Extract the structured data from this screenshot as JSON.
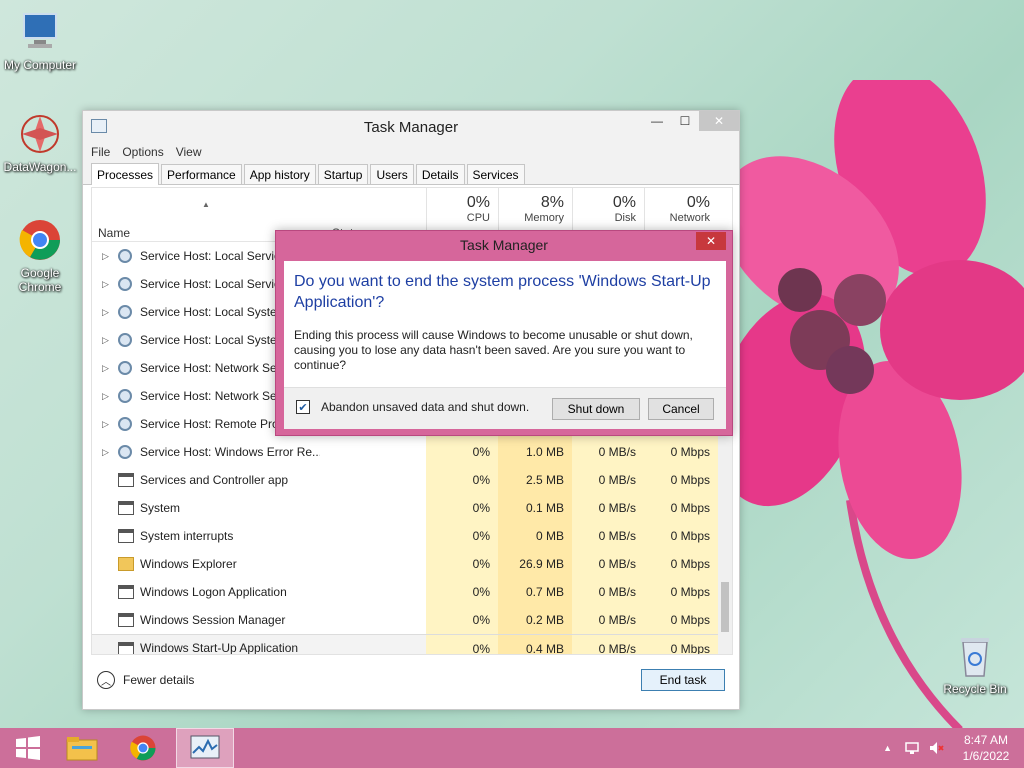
{
  "desktop": {
    "icons": [
      {
        "label": "My Computer"
      },
      {
        "label": "DataWagon..."
      },
      {
        "label": "Google Chrome"
      },
      {
        "label": "Recycle Bin"
      }
    ]
  },
  "window": {
    "title": "Task Manager",
    "minimize": "—",
    "maximize": "☐",
    "close": "✕",
    "menu": [
      "File",
      "Options",
      "View"
    ],
    "tabs": [
      "Processes",
      "Performance",
      "App history",
      "Startup",
      "Users",
      "Details",
      "Services"
    ],
    "active_tab": 0
  },
  "columns": {
    "name": "Name",
    "status": "Status",
    "cpu_pct": "0%",
    "cpu_label": "CPU",
    "mem_pct": "8%",
    "mem_label": "Memory",
    "disk_pct": "0%",
    "disk_label": "Disk",
    "net_pct": "0%",
    "net_label": "Network"
  },
  "processes": [
    {
      "name": "Service Host: Local Service",
      "cpu": "",
      "mem": "",
      "disk": "",
      "net": "",
      "icon": "gear-icon",
      "expand": true
    },
    {
      "name": "Service Host: Local Service",
      "cpu": "",
      "mem": "",
      "disk": "",
      "net": "",
      "icon": "gear-icon",
      "expand": true
    },
    {
      "name": "Service Host: Local System",
      "cpu": "",
      "mem": "",
      "disk": "",
      "net": "",
      "icon": "gear-icon",
      "expand": true
    },
    {
      "name": "Service Host: Local System",
      "cpu": "",
      "mem": "",
      "disk": "",
      "net": "",
      "icon": "gear-icon",
      "expand": true
    },
    {
      "name": "Service Host: Network Service",
      "cpu": "",
      "mem": "",
      "disk": "",
      "net": "",
      "icon": "gear-icon",
      "expand": true
    },
    {
      "name": "Service Host: Network Service",
      "cpu": "",
      "mem": "",
      "disk": "",
      "net": "",
      "icon": "gear-icon",
      "expand": true
    },
    {
      "name": "Service Host: Remote Procedure Call",
      "cpu": "",
      "mem": "",
      "disk": "",
      "net": "",
      "icon": "gear-icon",
      "expand": true
    },
    {
      "name": "Service Host: Windows Error Re...",
      "cpu": "0%",
      "mem": "1.0 MB",
      "disk": "0 MB/s",
      "net": "0 Mbps",
      "icon": "gear-icon",
      "expand": true
    },
    {
      "name": "Services and Controller app",
      "cpu": "0%",
      "mem": "2.5 MB",
      "disk": "0 MB/s",
      "net": "0 Mbps",
      "icon": "app-window-icon",
      "expand": false
    },
    {
      "name": "System",
      "cpu": "0%",
      "mem": "0.1 MB",
      "disk": "0 MB/s",
      "net": "0 Mbps",
      "icon": "app-window-icon",
      "expand": false
    },
    {
      "name": "System interrupts",
      "cpu": "0%",
      "mem": "0 MB",
      "disk": "0 MB/s",
      "net": "0 Mbps",
      "icon": "app-window-icon",
      "expand": false
    },
    {
      "name": "Windows Explorer",
      "cpu": "0%",
      "mem": "26.9 MB",
      "disk": "0 MB/s",
      "net": "0 Mbps",
      "icon": "folder-icon",
      "expand": false
    },
    {
      "name": "Windows Logon Application",
      "cpu": "0%",
      "mem": "0.7 MB",
      "disk": "0 MB/s",
      "net": "0 Mbps",
      "icon": "app-window-icon",
      "expand": false
    },
    {
      "name": "Windows Session Manager",
      "cpu": "0%",
      "mem": "0.2 MB",
      "disk": "0 MB/s",
      "net": "0 Mbps",
      "icon": "app-window-icon",
      "expand": false
    },
    {
      "name": "Windows Start-Up Application",
      "cpu": "0%",
      "mem": "0.4 MB",
      "disk": "0 MB/s",
      "net": "0 Mbps",
      "icon": "app-window-icon",
      "expand": false,
      "selected": true
    }
  ],
  "footer": {
    "fewer_details": "Fewer details",
    "end_task": "End task"
  },
  "dialog": {
    "title": "Task Manager",
    "close": "✕",
    "heading": "Do you want to end the system process 'Windows Start-Up Application'?",
    "text": "Ending this process will cause Windows to become unusable or shut down, causing you to lose any data hasn't been saved. Are you sure you want to continue?",
    "checkbox_label": "Abandon unsaved data and shut down.",
    "checkbox_checked": true,
    "shutdown": "Shut down",
    "cancel": "Cancel"
  },
  "taskbar": {
    "time": "8:47 AM",
    "date": "1/6/2022"
  },
  "colors": {
    "taskbar": "#cc6f9a",
    "dialog_frame": "#d6669b",
    "heading_blue": "#1e3fa3"
  }
}
